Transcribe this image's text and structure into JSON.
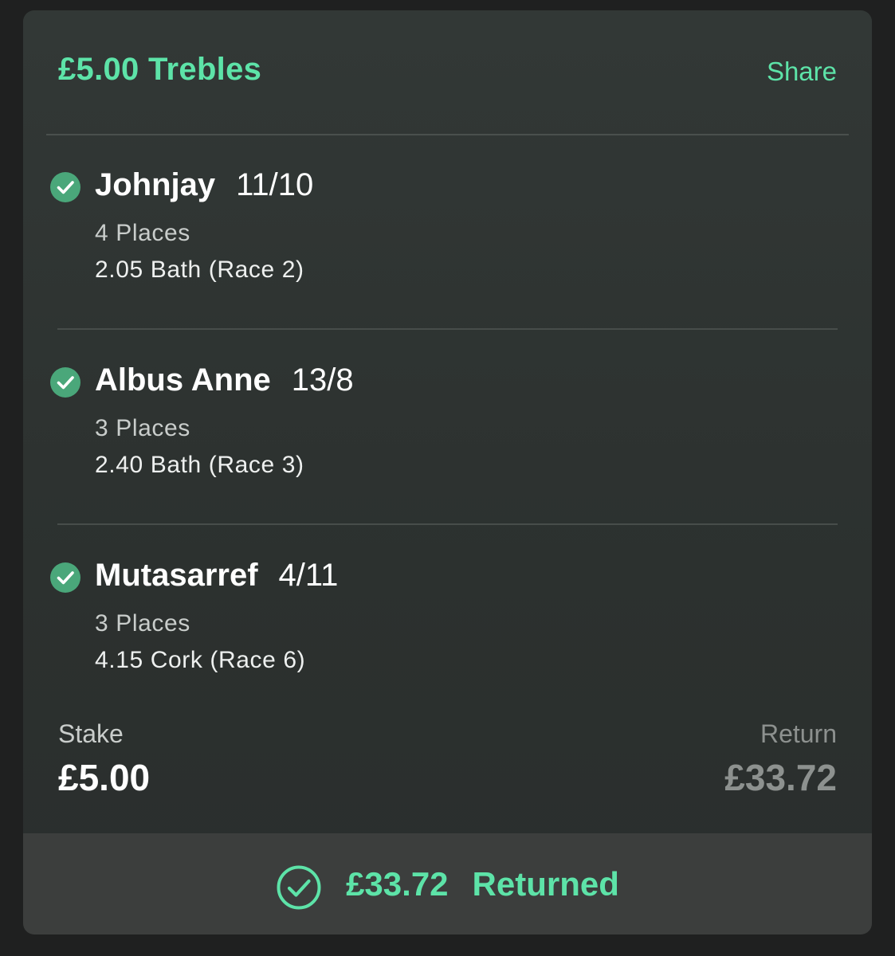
{
  "bet": {
    "title": "£5.00 Trebles",
    "share_label": "Share"
  },
  "selections": [
    {
      "name": "Johnjay",
      "odds": "11/10",
      "places": "4 Places",
      "race": "2.05 Bath (Race 2)"
    },
    {
      "name": "Albus Anne",
      "odds": "13/8",
      "places": "3 Places",
      "race": "2.40 Bath (Race 3)"
    },
    {
      "name": "Mutasarref",
      "odds": "4/11",
      "places": "3 Places",
      "race": "4.15 Cork (Race 6)"
    }
  ],
  "summary": {
    "stake_label": "Stake",
    "stake_value": "£5.00",
    "return_label": "Return",
    "return_value": "£33.72"
  },
  "footer": {
    "amount": "£33.72",
    "status": "Returned"
  },
  "colors": {
    "accent": "#5de3a8",
    "check_fill": "#4aa77a",
    "card_bg": "#2f3432",
    "footer_bg": "#3c3e3d"
  },
  "icons": {
    "selection_status": "check-circle-icon",
    "returned_status": "check-circle-outline-icon"
  }
}
